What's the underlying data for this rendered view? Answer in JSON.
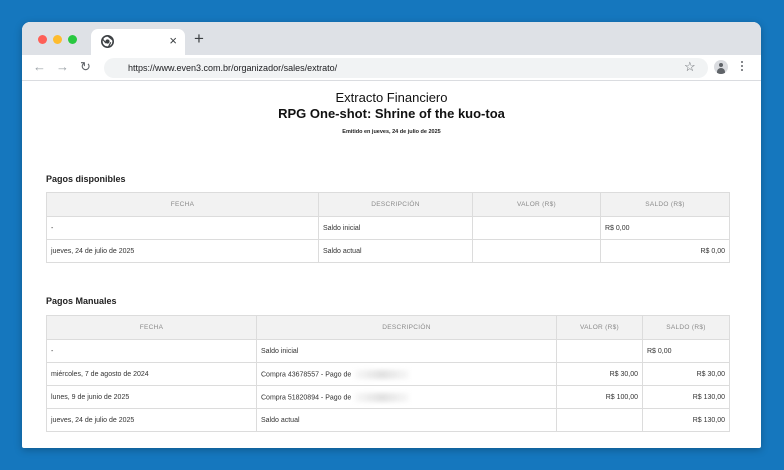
{
  "browser": {
    "url": "https://www.even3.com.br/organizador/sales/extrato/",
    "tab_close": "×",
    "new_tab": "+",
    "back_glyph": "←",
    "forward_glyph": "→",
    "reload_glyph": "↻",
    "star_glyph": "☆"
  },
  "document": {
    "title": "Extracto Financiero",
    "subtitle": "RPG One-shot: Shrine of the kuo-toa",
    "issued": "Emitido en jueves, 24 de julio de 2025"
  },
  "pagos_disponibles": {
    "title": "Pagos disponibles",
    "headers": [
      "FECHA",
      "DESCRIPCIÓN",
      "VALOR (R$)",
      "SALDO (R$)"
    ],
    "rows": [
      [
        "-",
        "Saldo inicial",
        "",
        "R$ 0,00"
      ],
      [
        "jueves, 24 de julio de 2025",
        "Saldo actual",
        "",
        "R$ 0,00"
      ]
    ]
  },
  "pagos_manuales": {
    "title": "Pagos Manuales",
    "headers": [
      "FECHA",
      "DESCRIPCIÓN",
      "VALOR (R$)",
      "SALDO (R$)"
    ],
    "rows": [
      [
        "-",
        "Saldo inicial",
        "",
        "R$ 0,00"
      ],
      [
        "miércoles, 7 de agosto de 2024",
        "Compra 43678557 - Pago de",
        "R$ 30,00",
        "R$ 30,00"
      ],
      [
        "lunes, 9 de junio de 2025",
        "Compra 51820894 - Pago de",
        "R$ 100,00",
        "R$ 130,00"
      ],
      [
        "jueves, 24 de julio de 2025",
        "Saldo actual",
        "",
        "R$ 130,00"
      ]
    ]
  }
}
